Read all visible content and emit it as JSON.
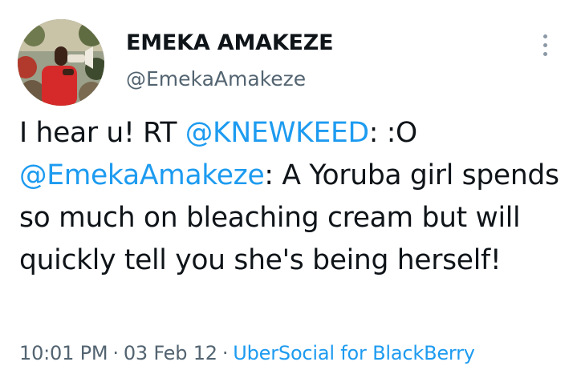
{
  "tweet": {
    "author": {
      "name": "EMEKA AMAKEZE",
      "handle": "@EmekaAmakeze"
    },
    "text": {
      "prefix": "I hear u! RT ",
      "mention1": "@KNEWKEED",
      "mid": ": :O ",
      "mention2": "@EmekaAmakeze",
      "rest": ": A Yoruba girl spends so much on bleaching cream but will quickly tell you she's being herself!"
    },
    "meta": {
      "time": "10:01 PM",
      "separator": "·",
      "date": "03 Feb 12",
      "source": "UberSocial for BlackBerry"
    },
    "icons": {
      "more": "more-vertical-icon"
    },
    "colors": {
      "link": "#1d9bf0",
      "secondary": "#536471",
      "text": "#0f1419"
    }
  }
}
